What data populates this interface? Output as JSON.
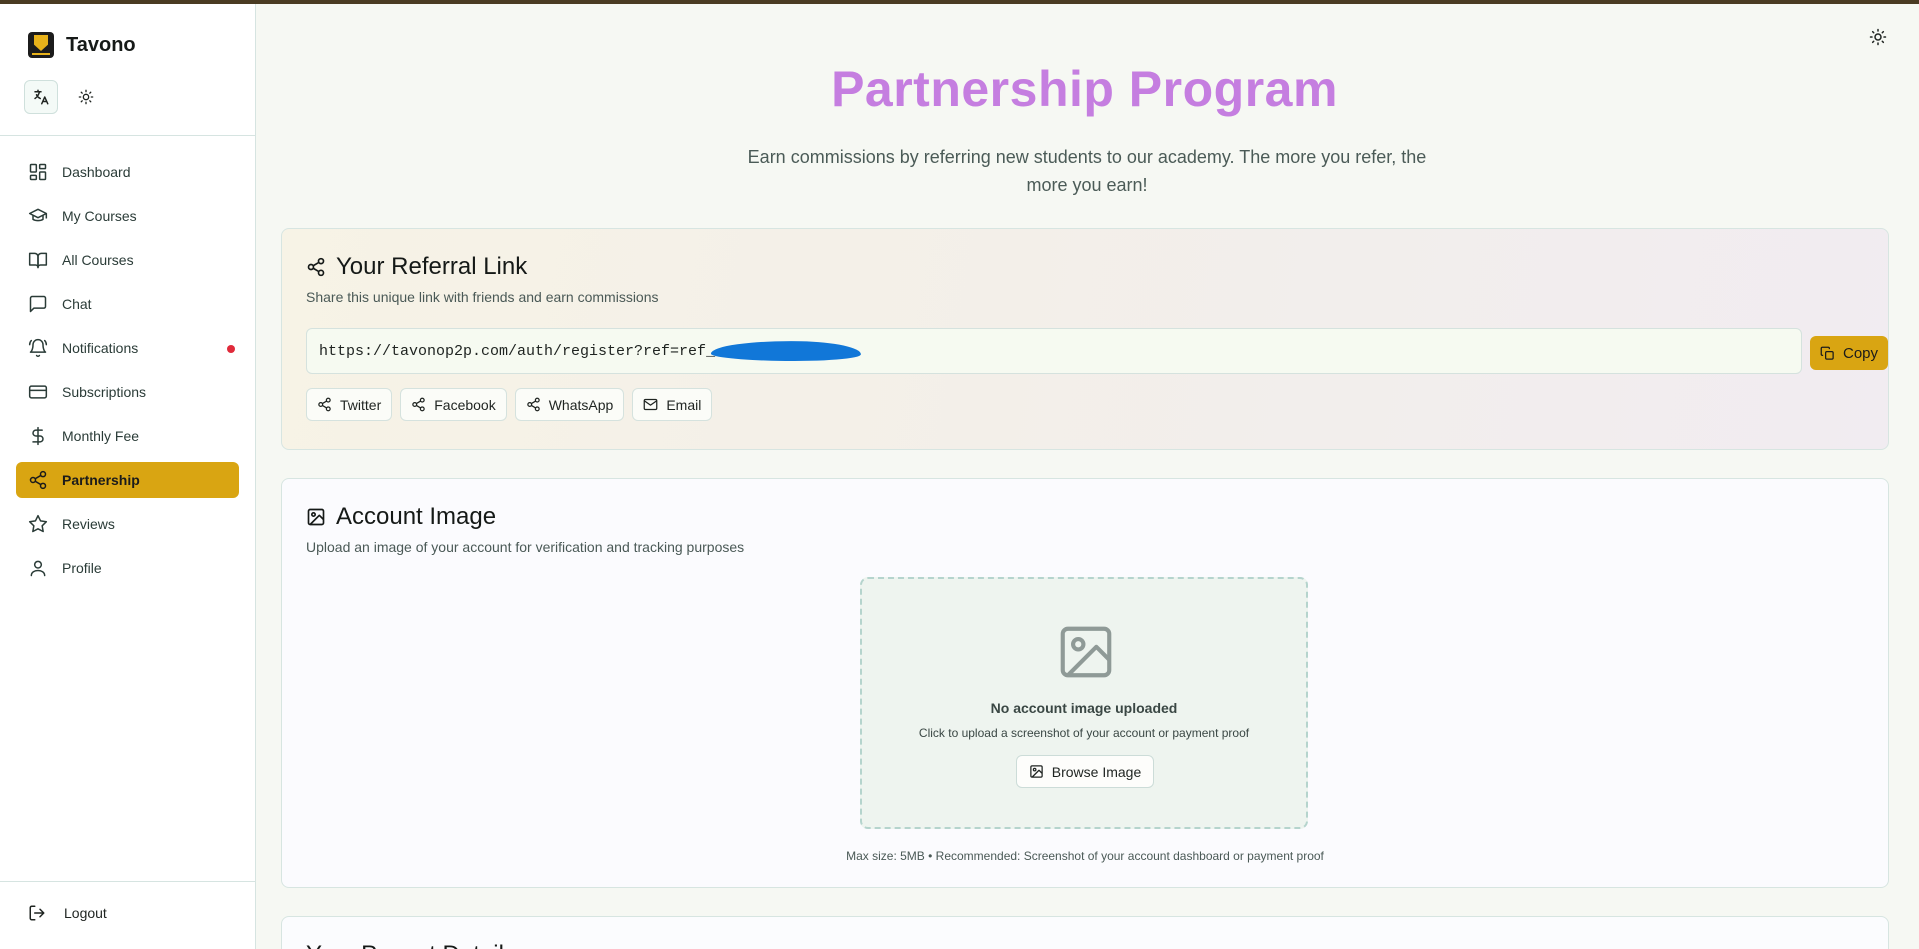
{
  "app": {
    "name": "Tavono"
  },
  "sidebar": {
    "items": [
      {
        "label": "Dashboard",
        "icon": "dashboard-icon",
        "active": false
      },
      {
        "label": "My Courses",
        "icon": "graduation-cap-icon",
        "active": false
      },
      {
        "label": "All Courses",
        "icon": "book-open-icon",
        "active": false
      },
      {
        "label": "Chat",
        "icon": "chat-icon",
        "active": false
      },
      {
        "label": "Notifications",
        "icon": "bell-icon",
        "active": false,
        "has_dot": true
      },
      {
        "label": "Subscriptions",
        "icon": "credit-card-icon",
        "active": false
      },
      {
        "label": "Monthly Fee",
        "icon": "dollar-icon",
        "active": false
      },
      {
        "label": "Partnership",
        "icon": "share-icon",
        "active": true
      },
      {
        "label": "Reviews",
        "icon": "star-icon",
        "active": false
      },
      {
        "label": "Profile",
        "icon": "user-icon",
        "active": false
      }
    ],
    "logout_label": "Logout"
  },
  "colors": {
    "accent": "#d9a512",
    "title": "#c57ee0",
    "notification_dot": "#e02a3a",
    "redaction": "#1177d8"
  },
  "page": {
    "title": "Partnership Program",
    "subtitle": "Earn commissions by referring new students to our academy. The more you refer, the more you earn!"
  },
  "referral": {
    "title": "Your Referral Link",
    "description": "Share this unique link with friends and earn commissions",
    "link": "https://tavonop2p.com/auth/register?ref=ref_",
    "copy_label": "Copy",
    "share": [
      {
        "label": "Twitter",
        "icon": "share-icon"
      },
      {
        "label": "Facebook",
        "icon": "share-icon"
      },
      {
        "label": "WhatsApp",
        "icon": "share-icon"
      },
      {
        "label": "Email",
        "icon": "mail-icon"
      }
    ]
  },
  "account_image": {
    "title": "Account Image",
    "description": "Upload an image of your account for verification and tracking purposes",
    "empty_title": "No account image uploaded",
    "empty_hint": "Click to upload a screenshot of your account or payment proof",
    "browse_label": "Browse Image",
    "max_size_note": "Max size: 5MB • Recommended: Screenshot of your account dashboard or payment proof"
  },
  "next_section": {
    "title": "Your Payout Details"
  }
}
